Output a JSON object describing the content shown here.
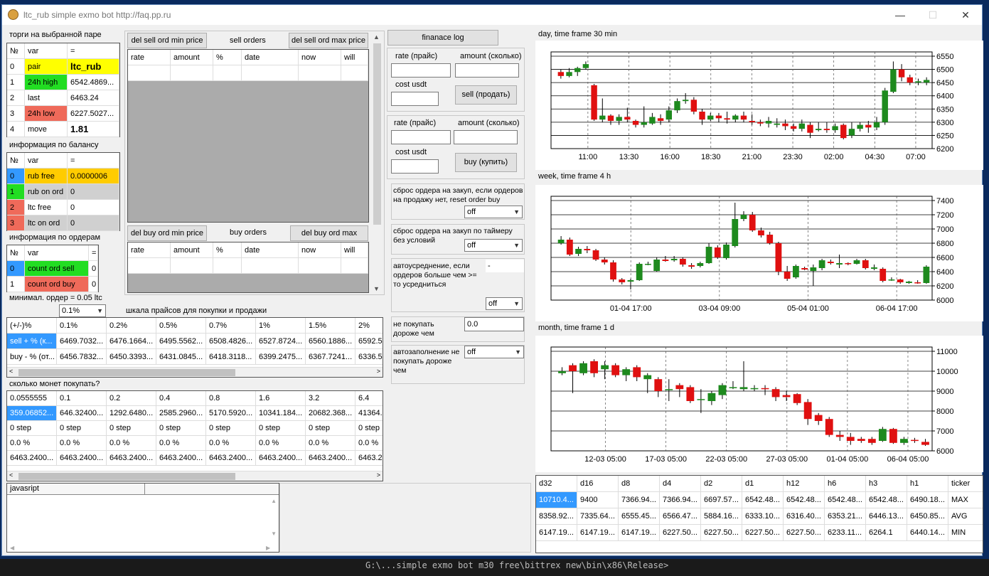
{
  "window": {
    "title": "ltc_rub simple exmo bot http://faq.pp.ru",
    "min": "—",
    "max": "☐",
    "close": "✕"
  },
  "pair_section": {
    "title": "торги на выбранной паре",
    "headers": [
      "№",
      "var",
      "="
    ],
    "rows": [
      {
        "n": "0",
        "var": "pair",
        "val": "ltc_rub",
        "vc": "#ffff00",
        "bc": "#ffff00"
      },
      {
        "n": "1",
        "var": "24h high",
        "val": "6542.4869...",
        "vc": "#22dd22",
        "bc": "#fff"
      },
      {
        "n": "2",
        "var": "last",
        "val": "6463.24",
        "vc": "#fff",
        "bc": "#fff"
      },
      {
        "n": "3",
        "var": "24h low",
        "val": "6227.5027...",
        "vc": "#ef6a5a",
        "bc": "#fff"
      },
      {
        "n": "4",
        "var": "move",
        "val": "1.81",
        "vc": "#fff",
        "bc": "#fff"
      }
    ]
  },
  "balance_section": {
    "title": "информация по балансу",
    "headers": [
      "№",
      "var",
      "="
    ],
    "rows": [
      {
        "n": "0",
        "var": "rub free",
        "val": "0.0000006",
        "nc": "#3399ff",
        "vc": "#ffcc00",
        "bc": "#ffcc00"
      },
      {
        "n": "1",
        "var": "rub on ord",
        "val": "0",
        "nc": "#22dd22",
        "vc": "#d0d0d0",
        "bc": "#d0d0d0"
      },
      {
        "n": "2",
        "var": "ltc free",
        "val": "0",
        "nc": "#ef6a5a",
        "vc": "#fff",
        "bc": "#fff"
      },
      {
        "n": "3",
        "var": "ltc on ord",
        "val": "0",
        "nc": "#ef6a5a",
        "vc": "#d0d0d0",
        "bc": "#d0d0d0"
      }
    ]
  },
  "orders_section": {
    "title": "информация по ордерам",
    "headers": [
      "№",
      "var",
      "="
    ],
    "rows": [
      {
        "n": "0",
        "var": "count ord sell",
        "val": "0",
        "nc": "#3399ff",
        "vc": "#22dd22"
      },
      {
        "n": "1",
        "var": "count ord buy",
        "val": "0",
        "nc": "#fff",
        "vc": "#ef6a5a"
      }
    ]
  },
  "min_order": {
    "label": "минимал. ордер = 0.05 ltc",
    "select": "0.1%"
  },
  "price_scale": {
    "title": "шкала прайсов для покупки и продажи",
    "headers": [
      "(+/-)%",
      "0.1%",
      "0.2%",
      "0.5%",
      "0.7%",
      "1%",
      "1.5%",
      "2%"
    ],
    "rows": [
      [
        "sell + % (к...",
        "6469.7032...",
        "6476.1664...",
        "6495.5562...",
        "6508.4826...",
        "6527.8724...",
        "6560.1886...",
        "6592.5"
      ],
      [
        "buy - % (от...",
        "6456.7832...",
        "6450.3393...",
        "6431.0845...",
        "6418.3118...",
        "6399.2475...",
        "6367.7241...",
        "6336.5"
      ]
    ]
  },
  "coins": {
    "title": "сколько монет покупать?",
    "headers": [
      "0.0555555",
      "0.1",
      "0.2",
      "0.4",
      "0.8",
      "1.6",
      "3.2",
      "6.4"
    ],
    "rows": [
      [
        "359.06852...",
        "646.32400...",
        "1292.6480...",
        "2585.2960...",
        "5170.5920...",
        "10341.184...",
        "20682.368...",
        "41364."
      ],
      [
        "0 step",
        "0 step",
        "0 step",
        "0 step",
        "0 step",
        "0 step",
        "0 step",
        "0 step"
      ],
      [
        "0.0 %",
        "0.0 %",
        "0.0 %",
        "0.0 %",
        "0.0 %",
        "0.0 %",
        "0.0 %",
        "0.0 %"
      ],
      [
        "6463.2400...",
        "6463.2400...",
        "6463.2400...",
        "6463.2400...",
        "6463.2400...",
        "6463.2400...",
        "6463.2400...",
        "6463.2"
      ]
    ]
  },
  "javascript": {
    "tab": "javasript"
  },
  "sell_orders": {
    "btn_min": "del sell ord min price",
    "title": "sell orders",
    "btn_max": "del sell ord max price",
    "headers": [
      "rate",
      "amount",
      "%",
      "date",
      "now",
      "will"
    ]
  },
  "buy_orders": {
    "btn_min": "del buy ord min price",
    "title": "buy orders",
    "btn_max": "del buy ord max",
    "headers": [
      "rate",
      "amount",
      "%",
      "date",
      "now",
      "will"
    ]
  },
  "finance_log": "finanace log",
  "sell_form": {
    "rate": "rate (прайс)",
    "amount": "amount (сколько)",
    "cost": "cost usdt",
    "btn": "sell (продать)"
  },
  "buy_form": {
    "rate": "rate (прайс)",
    "amount": "amount (сколько)",
    "cost": "cost usdt",
    "btn": "buy (купить)"
  },
  "reset1": {
    "text": "сброс ордера на закуп, если ордеров на продажу нет, reset order buy",
    "sel": "off"
  },
  "reset2": {
    "text": "сброс ордера на закуп по таймеру без условий",
    "sel": "off"
  },
  "avg": {
    "text": "автоусреднение, если ордеров больше чем >= то усредниться",
    "field": "-",
    "sel": "off"
  },
  "nobuy": {
    "text": "не покупать дороже чем",
    "val": "0.0"
  },
  "autofill": {
    "text": "автозаполнение не покупать дороже чем",
    "sel": "off"
  },
  "chart_data": [
    {
      "type": "candlestick",
      "title": "day, time frame 30 min",
      "x_ticks": [
        "11:00",
        "13:30",
        "16:00",
        "18:30",
        "21:00",
        "23:30",
        "02:00",
        "04:30",
        "07:00"
      ],
      "y_ticks": [
        6550,
        6500,
        6450,
        6400,
        6350,
        6300,
        6250,
        6200
      ],
      "ylim": [
        6200,
        6550
      ],
      "candles": [
        [
          6490,
          6475,
          6500,
          6465
        ],
        [
          6475,
          6490,
          6505,
          6470
        ],
        [
          6490,
          6505,
          6510,
          6475
        ],
        [
          6505,
          6520,
          6530,
          6500
        ],
        [
          6440,
          6310,
          6445,
          6305
        ],
        [
          6310,
          6325,
          6390,
          6300
        ],
        [
          6325,
          6305,
          6330,
          6290
        ],
        [
          6305,
          6320,
          6330,
          6290
        ],
        [
          6320,
          6310,
          6355,
          6300
        ],
        [
          6305,
          6290,
          6310,
          6280
        ],
        [
          6290,
          6300,
          6360,
          6280
        ],
        [
          6295,
          6320,
          6335,
          6290
        ],
        [
          6315,
          6305,
          6330,
          6290
        ],
        [
          6310,
          6345,
          6360,
          6300
        ],
        [
          6345,
          6380,
          6390,
          6335
        ],
        [
          6380,
          6385,
          6410,
          6370
        ],
        [
          6385,
          6340,
          6395,
          6330
        ],
        [
          6340,
          6310,
          6350,
          6290
        ],
        [
          6310,
          6325,
          6335,
          6305
        ],
        [
          6325,
          6315,
          6335,
          6300
        ],
        [
          6315,
          6310,
          6340,
          6295
        ],
        [
          6310,
          6325,
          6330,
          6300
        ],
        [
          6325,
          6310,
          6340,
          6300
        ],
        [
          6305,
          6300,
          6330,
          6290
        ],
        [
          6300,
          6295,
          6310,
          6285
        ],
        [
          6295,
          6305,
          6320,
          6280
        ],
        [
          6290,
          6295,
          6315,
          6280
        ],
        [
          6295,
          6285,
          6310,
          6270
        ],
        [
          6285,
          6275,
          6295,
          6265
        ],
        [
          6275,
          6295,
          6310,
          6265
        ],
        [
          6290,
          6260,
          6300,
          6240
        ],
        [
          6270,
          6275,
          6300,
          6265
        ],
        [
          6275,
          6270,
          6300,
          6260
        ],
        [
          6270,
          6285,
          6295,
          6260
        ],
        [
          6290,
          6240,
          6295,
          6235
        ],
        [
          6250,
          6275,
          6300,
          6240
        ],
        [
          6275,
          6290,
          6300,
          6265
        ],
        [
          6290,
          6280,
          6305,
          6260
        ],
        [
          6280,
          6300,
          6320,
          6270
        ],
        [
          6300,
          6420,
          6430,
          6290
        ],
        [
          6415,
          6500,
          6530,
          6410
        ],
        [
          6500,
          6470,
          6520,
          6455
        ],
        [
          6470,
          6450,
          6480,
          6440
        ],
        [
          6450,
          6455,
          6465,
          6440
        ],
        [
          6450,
          6460,
          6470,
          6440
        ]
      ]
    },
    {
      "type": "candlestick",
      "title": "week, time frame 4 h",
      "x_ticks": [
        "01-04 17:00",
        "03-04 09:00",
        "05-04 01:00",
        "06-04 17:00"
      ],
      "y_ticks": [
        7400,
        7200,
        7000,
        6800,
        6600,
        6400,
        6200,
        6000
      ],
      "ylim": [
        6000,
        7400
      ],
      "candles": [
        [
          6800,
          6850,
          6900,
          6780
        ],
        [
          6850,
          6640,
          6880,
          6620
        ],
        [
          6650,
          6720,
          6750,
          6620
        ],
        [
          6720,
          6700,
          6760,
          6660
        ],
        [
          6700,
          6570,
          6720,
          6550
        ],
        [
          6570,
          6530,
          6600,
          6500
        ],
        [
          6530,
          6290,
          6560,
          6260
        ],
        [
          6290,
          6250,
          6310,
          6220
        ],
        [
          6260,
          6280,
          6300,
          6150
        ],
        [
          6280,
          6510,
          6530,
          6270
        ],
        [
          6500,
          6510,
          6540,
          6490
        ],
        [
          6410,
          6570,
          6600,
          6400
        ],
        [
          6570,
          6550,
          6620,
          6540
        ],
        [
          6560,
          6580,
          6620,
          6540
        ],
        [
          6580,
          6500,
          6600,
          6470
        ],
        [
          6490,
          6470,
          6520,
          6440
        ],
        [
          6480,
          6520,
          6540,
          6460
        ],
        [
          6520,
          6750,
          6800,
          6510
        ],
        [
          6740,
          6600,
          6770,
          6580
        ],
        [
          6590,
          6780,
          6810,
          6570
        ],
        [
          6760,
          7140,
          7370,
          6740
        ],
        [
          7140,
          7200,
          7250,
          7110
        ],
        [
          7200,
          6980,
          7240,
          6960
        ],
        [
          6980,
          6910,
          7020,
          6880
        ],
        [
          6920,
          6800,
          6960,
          6780
        ],
        [
          6800,
          6400,
          6820,
          6350
        ],
        [
          6400,
          6300,
          6480,
          6270
        ],
        [
          6320,
          6480,
          6500,
          6300
        ],
        [
          6450,
          6430,
          6470,
          6420
        ],
        [
          6410,
          6460,
          6500,
          6200
        ],
        [
          6450,
          6560,
          6580,
          6420
        ],
        [
          6540,
          6520,
          6570,
          6500
        ],
        [
          6500,
          6520,
          6640,
          6450
        ],
        [
          6520,
          6510,
          6530,
          6490
        ],
        [
          6510,
          6560,
          6580,
          6500
        ],
        [
          6560,
          6450,
          6580,
          6430
        ],
        [
          6440,
          6460,
          6500,
          6420
        ],
        [
          6440,
          6270,
          6460,
          6250
        ],
        [
          6280,
          6290,
          6320,
          6270
        ],
        [
          6290,
          6250,
          6300,
          6230
        ],
        [
          6240,
          6260,
          6270,
          6230
        ],
        [
          6250,
          6240,
          6280,
          6230
        ],
        [
          6240,
          6470,
          6490,
          6230
        ]
      ]
    },
    {
      "type": "candlestick",
      "title": "month, time frame 1 d",
      "x_ticks": [
        "12-03 05:00",
        "17-03 05:00",
        "22-03 05:00",
        "27-03 05:00",
        "01-04 05:00",
        "06-04 05:00"
      ],
      "y_ticks": [
        11000,
        10000,
        9000,
        8000,
        7000,
        6000
      ],
      "ylim": [
        6000,
        11000
      ],
      "candles": [
        [
          9900,
          10000,
          10200,
          9800
        ],
        [
          10300,
          10000,
          10400,
          8900
        ],
        [
          9900,
          10400,
          10500,
          9800
        ],
        [
          10500,
          9900,
          10600,
          9700
        ],
        [
          10100,
          10300,
          10500,
          9600
        ],
        [
          10300,
          9800,
          10400,
          9700
        ],
        [
          9800,
          10100,
          10200,
          9500
        ],
        [
          10200,
          9700,
          10300,
          9500
        ],
        [
          9600,
          9800,
          9900,
          8900
        ],
        [
          9600,
          9000,
          9700,
          8700
        ],
        [
          9050,
          9100,
          9600,
          8500
        ],
        [
          9300,
          9100,
          9400,
          8700
        ],
        [
          9200,
          8500,
          9300,
          8400
        ],
        [
          8600,
          8600,
          9100,
          7900
        ],
        [
          8500,
          8900,
          9000,
          8300
        ],
        [
          8800,
          9300,
          9400,
          8600
        ],
        [
          9200,
          9200,
          9500,
          9100
        ],
        [
          9100,
          9200,
          10500,
          9000
        ],
        [
          9100,
          9150,
          9300,
          9000
        ],
        [
          9150,
          9100,
          9300,
          8800
        ],
        [
          9100,
          8700,
          9200,
          8500
        ],
        [
          8800,
          8700,
          9000,
          8500
        ],
        [
          8850,
          8400,
          8900,
          8300
        ],
        [
          8450,
          7600,
          8600,
          7300
        ],
        [
          7800,
          7500,
          7900,
          7300
        ],
        [
          7600,
          6800,
          7700,
          6700
        ],
        [
          6800,
          6700,
          7000,
          6500
        ],
        [
          6700,
          6500,
          6900,
          6300
        ],
        [
          6600,
          6500,
          6700,
          6400
        ],
        [
          6600,
          6400,
          6700,
          6300
        ],
        [
          6500,
          7100,
          7200,
          6450
        ],
        [
          7100,
          6400,
          7150,
          6350
        ],
        [
          6400,
          6600,
          6700,
          6300
        ],
        [
          6550,
          6500,
          6650,
          6400
        ],
        [
          6450,
          6300,
          6600,
          6250
        ]
      ]
    }
  ],
  "stats": {
    "headers": [
      "d32",
      "d16",
      "d8",
      "d4",
      "d2",
      "d1",
      "h12",
      "h6",
      "h3",
      "h1",
      "ticker"
    ],
    "rows": [
      [
        "10710.4...",
        "9400",
        "7366.94...",
        "7366.94...",
        "6697.57...",
        "6542.48...",
        "6542.48...",
        "6542.48...",
        "6542.48...",
        "6490.18...",
        "MAX"
      ],
      [
        "8358.92...",
        "7335.64...",
        "6555.45...",
        "6566.47...",
        "5884.16...",
        "6333.10...",
        "6316.40...",
        "6353.21...",
        "6446.13...",
        "6450.85...",
        "AVG"
      ],
      [
        "6147.19...",
        "6147.19...",
        "6147.19...",
        "6227.50...",
        "6227.50...",
        "6227.50...",
        "6227.50...",
        "6233.11...",
        "6264.1",
        "6440.14...",
        "MIN"
      ]
    ]
  },
  "console_text": "G:\\...simple exmo bot m30 free\\bittrex new\\bin\\x86\\Release>"
}
